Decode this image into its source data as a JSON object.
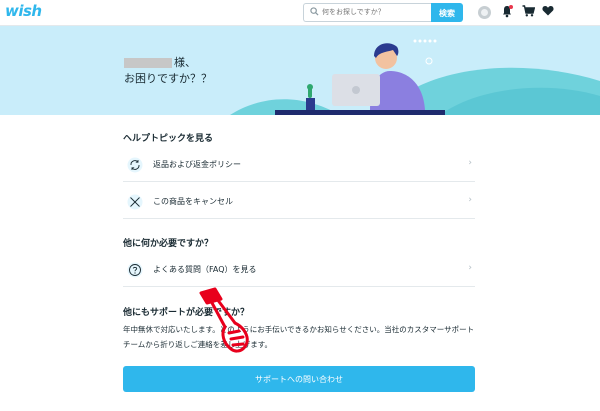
{
  "header": {
    "logo": "wish",
    "search_placeholder": "何をお探しですか？",
    "search_button": "検索"
  },
  "hero": {
    "name_suffix": "様、",
    "subtitle": "お困りですか？？"
  },
  "help_topics": {
    "title": "ヘルプトピックを見る",
    "items": [
      {
        "label": "返品および返金ポリシー",
        "icon": "refresh-icon"
      },
      {
        "label": "この商品をキャンセル",
        "icon": "cancel-x-icon"
      }
    ]
  },
  "need_more": {
    "title": "他に何か必要ですか？",
    "items": [
      {
        "label": "よくある質問（FAQ）を見る",
        "icon": "question-icon"
      }
    ]
  },
  "support": {
    "title": "他にもサポートが必要ですか？",
    "description": "年中無休で対応いたします。どのようにお手伝いできるかお知らせください。当社のカスタマーサポートチームから折り返しご連絡を差し上げます。",
    "button": "サポートへの問い合わせ"
  },
  "colors": {
    "brand": "#2fb7ec",
    "hero_bg": "#c9edfa",
    "annotation": "#e8001c"
  }
}
